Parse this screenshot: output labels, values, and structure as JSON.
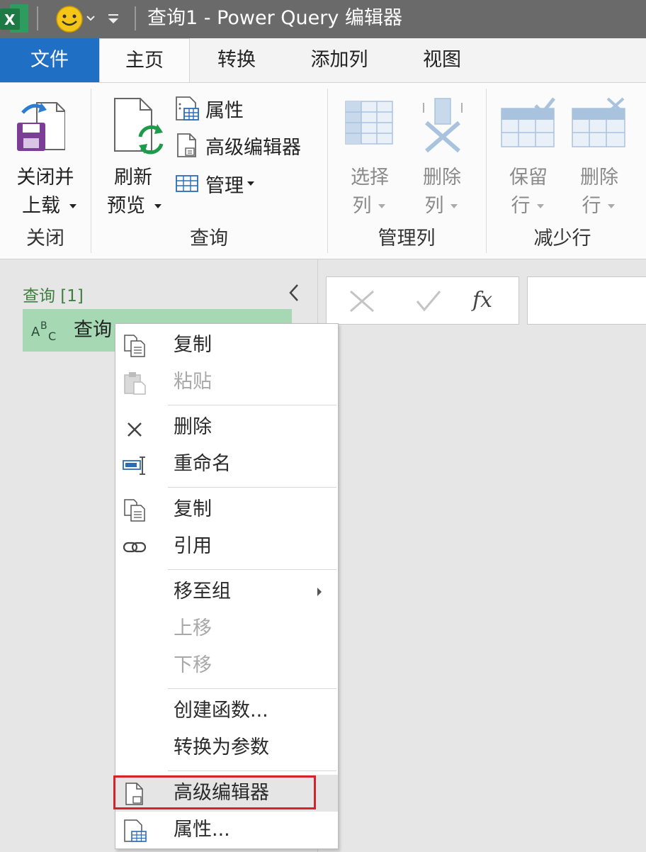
{
  "window": {
    "title": "查询1 - Power Query 编辑器"
  },
  "tabs": {
    "file": "文件",
    "home": "主页",
    "transform": "转换",
    "add_column": "添加列",
    "view": "视图"
  },
  "ribbon": {
    "close_load": {
      "line1": "关闭并",
      "line2": "上载"
    },
    "refresh_preview": {
      "line1": "刷新",
      "line2": "预览"
    },
    "properties": "属性",
    "advanced_editor": "高级编辑器",
    "manage": "管理",
    "choose_columns": {
      "line1": "选择",
      "line2": "列"
    },
    "remove_columns": {
      "line1": "删除",
      "line2": "列"
    },
    "keep_rows": {
      "line1": "保留",
      "line2": "行"
    },
    "remove_rows": {
      "line1": "删除",
      "line2": "行"
    },
    "groups": {
      "close": "关闭",
      "query": "查询",
      "manage_columns": "管理列",
      "reduce_rows": "减少行"
    }
  },
  "queries_pane": {
    "title": "查询 [1]",
    "item_name": "查询"
  },
  "formula_bar": {
    "fx": "fx"
  },
  "context_menu": [
    {
      "label": "复制",
      "icon": "copy-icon",
      "enabled": true
    },
    {
      "label": "粘贴",
      "icon": "paste-icon",
      "enabled": false
    },
    {
      "label": "删除",
      "icon": "delete-icon",
      "enabled": true
    },
    {
      "label": "重命名",
      "icon": "rename-icon",
      "enabled": true
    },
    {
      "label": "复制",
      "icon": "duplicate-icon",
      "enabled": true
    },
    {
      "label": "引用",
      "icon": "reference-icon",
      "enabled": true
    },
    {
      "label": "移至组",
      "icon": "",
      "enabled": true,
      "submenu": true
    },
    {
      "label": "上移",
      "icon": "",
      "enabled": false
    },
    {
      "label": "下移",
      "icon": "",
      "enabled": false
    },
    {
      "label": "创建函数...",
      "icon": "",
      "enabled": true
    },
    {
      "label": "转换为参数",
      "icon": "",
      "enabled": true
    },
    {
      "label": "高级编辑器",
      "icon": "advanced-editor-icon",
      "enabled": true,
      "highlighted": true
    },
    {
      "label": "属性...",
      "icon": "properties-icon",
      "enabled": true
    }
  ],
  "colors": {
    "file_tab": "#1f6fc5",
    "title_bar": "#6a6a6a",
    "selected_query": "#a6d8b4",
    "highlight_box": "#d5232a",
    "excel_green": "#1d7a45"
  }
}
